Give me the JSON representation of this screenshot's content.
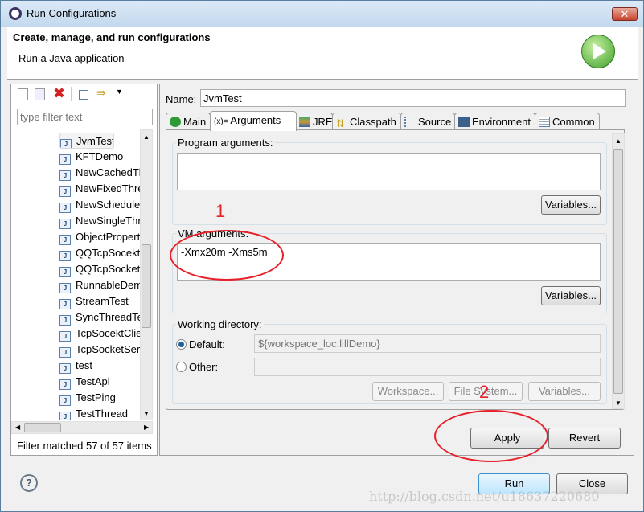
{
  "window": {
    "title": "Run Configurations"
  },
  "header": {
    "title": "Create, manage, and run configurations",
    "subtitle": "Run a Java application"
  },
  "left": {
    "filter_placeholder": "type filter text",
    "items": [
      "JvmTest",
      "KFTDemo",
      "NewCachedThre",
      "NewFixedThrea",
      "NewScheduledT",
      "NewSingleThrea",
      "ObjectPropertie",
      "QQTcpSocektCl",
      "QQTcpSocketSe",
      "RunnableDemo",
      "StreamTest",
      "SyncThreadTest",
      "TcpSocektClient",
      "TcpSocketServe",
      "test",
      "TestApi",
      "TestPing",
      "TestThread"
    ],
    "selected": "JvmTest",
    "status": "Filter matched 57 of 57 items"
  },
  "config": {
    "name_label": "Name:",
    "name_value": "JvmTest",
    "tabs": [
      "Main",
      "Arguments",
      "JRE",
      "Classpath",
      "Source",
      "Environment",
      "Common"
    ],
    "active_tab": "Arguments",
    "program_args_label": "Program arguments:",
    "program_args_value": "",
    "variables_label": "Variables...",
    "vm_args_label": "VM arguments:",
    "vm_args_value": "-Xmx20m -Xms5m",
    "working_dir_label": "Working directory:",
    "default_label": "Default:",
    "default_value": "${workspace_loc:lillDemo}",
    "other_label": "Other:",
    "other_value": "",
    "workspace_btn": "Workspace...",
    "filesystem_btn": "File System...",
    "apply": "Apply",
    "revert": "Revert"
  },
  "footer": {
    "run": "Run",
    "close": "Close"
  },
  "annotations": {
    "one": "1",
    "two": "2",
    "color": "#e8202a"
  },
  "watermark": "http://blog.csdn.net/u18637220680"
}
